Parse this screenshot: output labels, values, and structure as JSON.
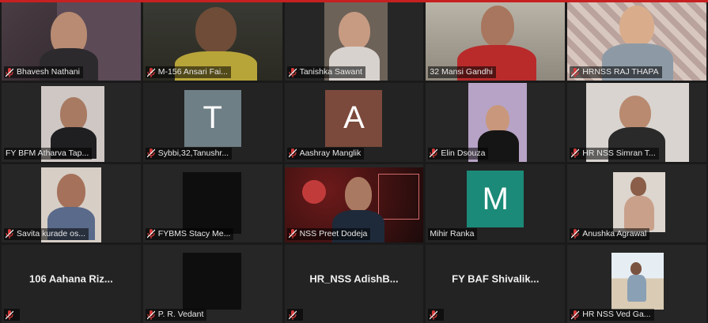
{
  "colors": {
    "accent_border": "#c9d84a",
    "muted_mic": "#d73a3a",
    "top_bar": "#c62020"
  },
  "icons": {
    "muted": "mic-muted-icon"
  },
  "participants": [
    {
      "name": "Bhavesh Nathani",
      "muted": true
    },
    {
      "name": "M-156 Ansari Fai...",
      "muted": true
    },
    {
      "name": "Tanishka Sawant",
      "muted": true
    },
    {
      "name": "32 Mansi Gandhi",
      "muted": false
    },
    {
      "name": "HRNSS RAJ THAPA",
      "muted": true
    },
    {
      "name": "FY BFM Atharva Tap...",
      "muted": false,
      "active": true
    },
    {
      "name": "Sybbi,32,Tanushr...",
      "muted": true,
      "avatar": "T",
      "avatar_color": "#6f7f86"
    },
    {
      "name": "Aashray Manglik",
      "muted": true,
      "avatar": "A",
      "avatar_color": "#7b4a3c"
    },
    {
      "name": "Elin Dsouza",
      "muted": true
    },
    {
      "name": "HR NSS Simran T...",
      "muted": true
    },
    {
      "name": "Savita kurade os...",
      "muted": true
    },
    {
      "name": "FYBMS Stacy Me...",
      "muted": true
    },
    {
      "name": "NSS Preet Dodeja",
      "muted": true
    },
    {
      "name": "Mihir Ranka",
      "muted": false,
      "avatar": "M",
      "avatar_color": "#1b8a78"
    },
    {
      "name": "Anushka Agrawal",
      "muted": true
    },
    {
      "name": "106 Aahana Riz...",
      "muted": true
    },
    {
      "name": "P. R. Vedant",
      "muted": true
    },
    {
      "name": "HR_NSS AdishB...",
      "muted": true
    },
    {
      "name": "FY BAF Shivalik...",
      "muted": true
    },
    {
      "name": "HR NSS Ved Ga...",
      "muted": true
    }
  ]
}
